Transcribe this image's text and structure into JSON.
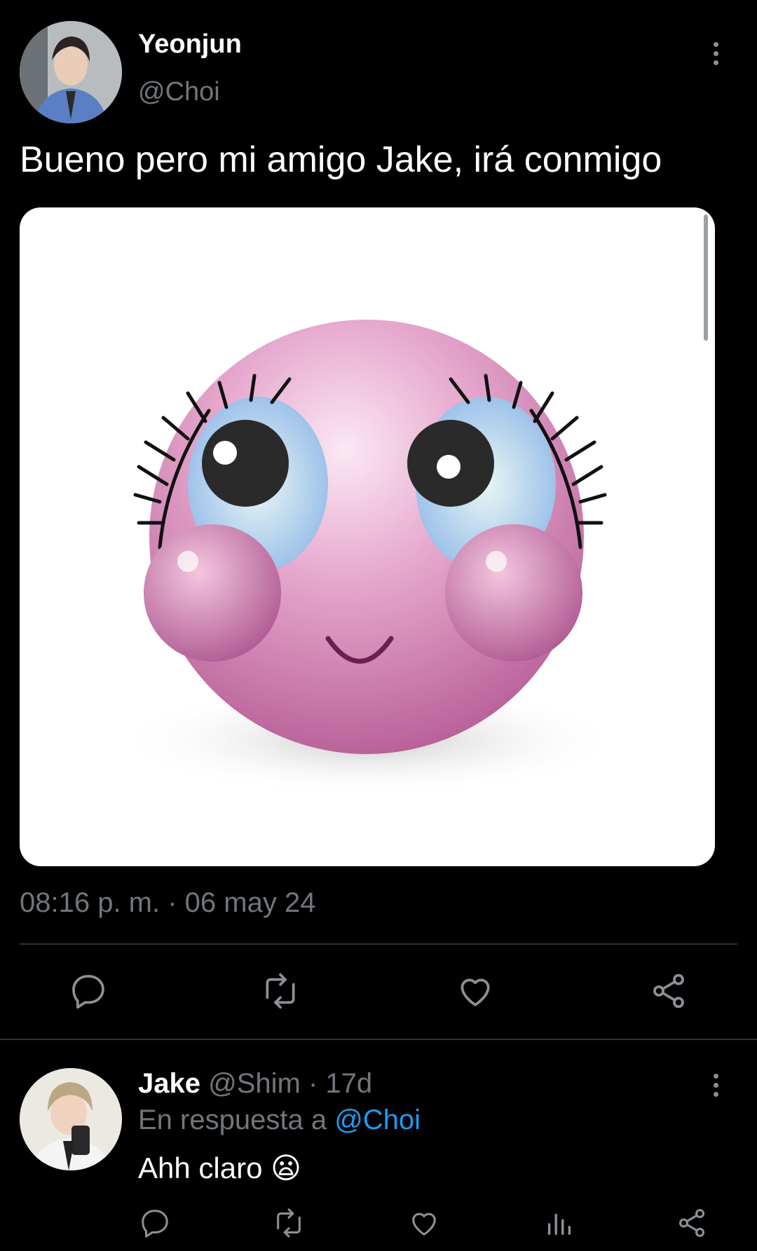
{
  "tweet": {
    "author_name": "Yeonjun",
    "author_handle": "@Choi",
    "text": "Bueno pero mi amigo Jake, irá conmigo",
    "timestamp": "08:16 p. m. · 06 may 24",
    "media_description": "pink blushing emoji face"
  },
  "reply": {
    "author_name": "Jake",
    "author_handle": "@Shim",
    "age": "· 17d",
    "replying_prefix": "En respuesta a",
    "replying_to": "@Choi",
    "text": "Ahh claro",
    "emoji": "😦"
  },
  "icons": {
    "more": "more-vertical-icon",
    "reply": "reply-icon",
    "retweet": "retweet-icon",
    "like": "like-icon",
    "share": "share-icon",
    "views": "views-icon"
  },
  "colors": {
    "background": "#000000",
    "text": "#e7e9ea",
    "muted": "#71767b",
    "link": "#1d9bf0",
    "divider": "#2f3336"
  }
}
